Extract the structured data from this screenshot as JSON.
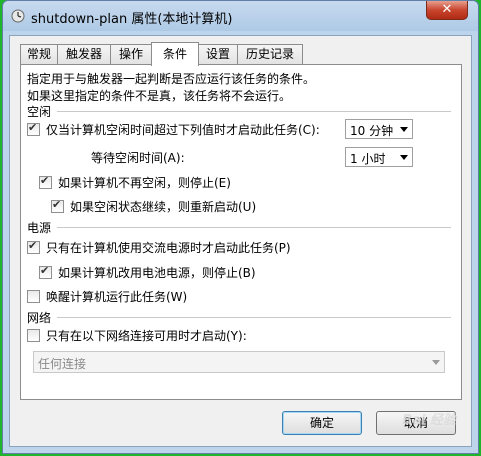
{
  "window": {
    "title": "shutdown-plan 属性(本地计算机)",
    "close_label": "✕"
  },
  "tabs": [
    {
      "label": "常规",
      "active": false
    },
    {
      "label": "触发器",
      "active": false
    },
    {
      "label": "操作",
      "active": false
    },
    {
      "label": "条件",
      "active": true
    },
    {
      "label": "设置",
      "active": false
    },
    {
      "label": "历史记录",
      "active": false
    }
  ],
  "conditions": {
    "description_line1": "指定用于与触发器一起判断是否应运行该任务的条件。",
    "description_line2": "如果这里指定的条件不是真，该任务将不会运行。",
    "idle": {
      "section_label": "空闲",
      "start_only_if_idle": {
        "label": "仅当计算机空闲时间超过下列值时才启动此任务(C):",
        "checked": true
      },
      "idle_duration": "10 分钟",
      "wait_label": "等待空闲时间(A):",
      "wait_duration": "1 小时",
      "stop_if_not_idle": {
        "label": "如果计算机不再空闲，则停止(E)",
        "checked": true
      },
      "restart_if_idle_resumes": {
        "label": "如果空闲状态继续，则重新启动(U)",
        "checked": true
      }
    },
    "power": {
      "section_label": "电源",
      "start_only_on_ac": {
        "label": "只有在计算机使用交流电源时才启动此任务(P)",
        "checked": true
      },
      "stop_on_battery": {
        "label": "如果计算机改用电池电源，则停止(B)",
        "checked": true
      },
      "wake_to_run": {
        "label": "唤醒计算机运行此任务(W)",
        "checked": false
      }
    },
    "network": {
      "section_label": "网络",
      "start_only_if_network": {
        "label": "只有在以下网络连接可用时才启动(Y):",
        "checked": false
      },
      "connection": "任何连接"
    }
  },
  "buttons": {
    "ok": "确定",
    "cancel": "取消"
  },
  "watermark": "Bai 经验"
}
